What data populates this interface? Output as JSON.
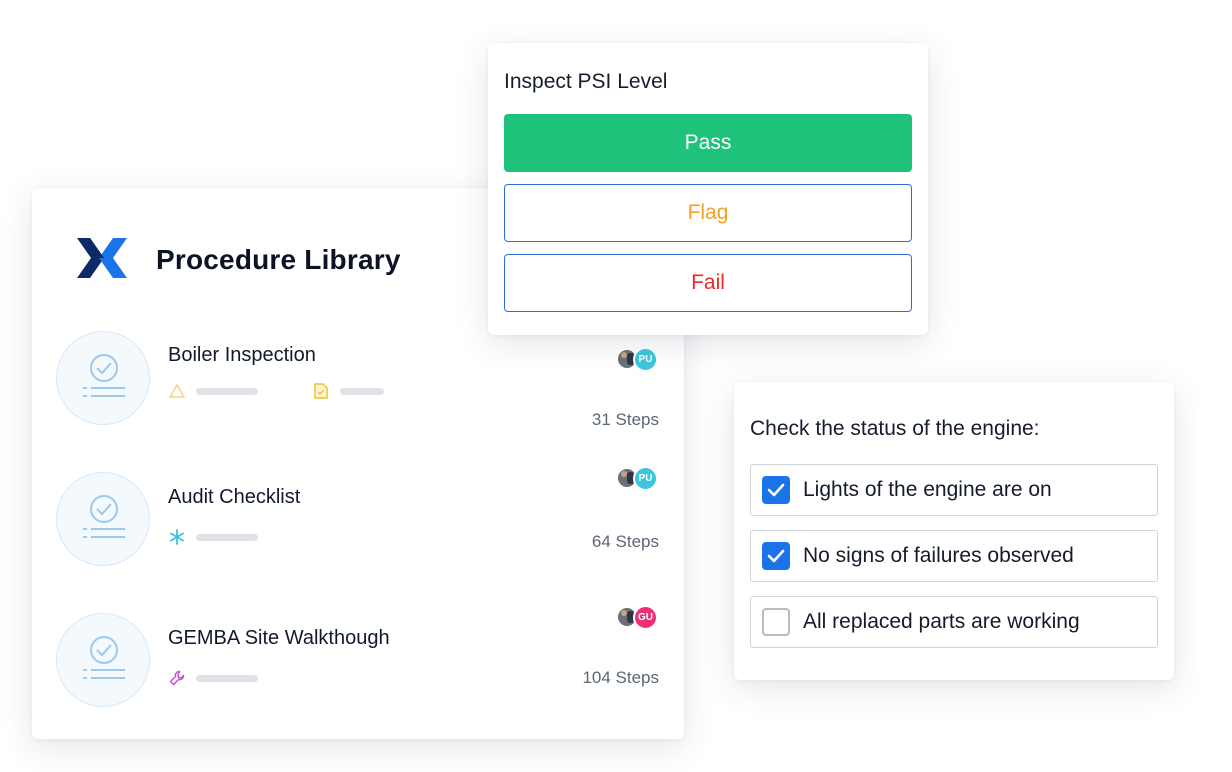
{
  "library": {
    "title": "Procedure Library",
    "procedures": [
      {
        "name": "Boiler Inspection",
        "steps": "31 Steps",
        "meta_icons": [
          "warning-triangle-icon",
          "document-check-icon"
        ],
        "avatar_initials": "PU",
        "avatar_color": "#3bc7de"
      },
      {
        "name": "Audit Checklist",
        "steps": "64 Steps",
        "meta_icons": [
          "snowflake-icon"
        ],
        "avatar_initials": "PU",
        "avatar_color": "#3bc7de"
      },
      {
        "name": "GEMBA Site Walkthough",
        "steps": "104 Steps",
        "meta_icons": [
          "wrench-icon"
        ],
        "avatar_initials": "GU",
        "avatar_color": "#ee2f78"
      }
    ]
  },
  "psi": {
    "title": "Inspect PSI Level",
    "options": {
      "pass": "Pass",
      "flag": "Flag",
      "fail": "Fail"
    },
    "colors": {
      "pass": "#1fc27a",
      "flag": "#f2a12a",
      "fail": "#ea2a2a",
      "outline": "#2a6fdb"
    }
  },
  "engine": {
    "title": "Check the status of the engine:",
    "items": [
      {
        "label": "Lights of the engine are on",
        "checked": true
      },
      {
        "label": "No signs of failures observed",
        "checked": true
      },
      {
        "label": "All replaced parts are working",
        "checked": false
      }
    ],
    "check_color": "#1a73e8"
  }
}
